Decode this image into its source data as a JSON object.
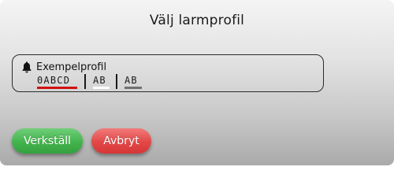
{
  "dialog": {
    "title": "Välj larmprofil"
  },
  "profile": {
    "icon": "bell-icon",
    "name": "Exempelprofil",
    "codes": [
      {
        "text": "0ABCD",
        "color": "#d01010"
      },
      {
        "text": "AB",
        "color": "#ffffff"
      },
      {
        "text": "AB",
        "color": "#707070"
      }
    ]
  },
  "buttons": {
    "apply_label": "Verkställ",
    "apply_color": "#43b34d",
    "cancel_label": "Avbryt",
    "cancel_color": "#e24848"
  }
}
